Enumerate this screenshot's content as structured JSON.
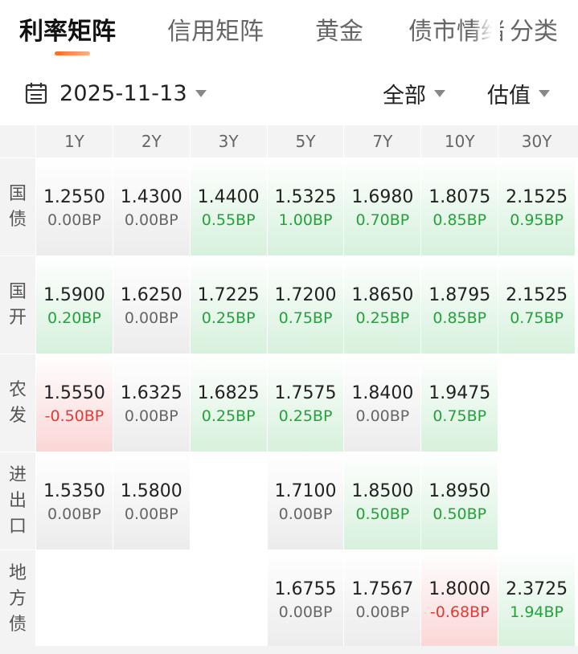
{
  "tabs": [
    {
      "label": "利率矩阵",
      "active": true
    },
    {
      "label": "信用矩阵",
      "active": false
    },
    {
      "label": "黄金",
      "active": false
    },
    {
      "label": "债市情绪",
      "active": false
    },
    {
      "label": "分类",
      "active": false
    }
  ],
  "filter": {
    "date": "2025-11-13",
    "scope": "全部",
    "metric": "估值"
  },
  "colors": {
    "up": "#22a33a",
    "down": "#e53935",
    "flat": "#666666",
    "accent": "#ff6a1f"
  },
  "matrix": {
    "columns": [
      "1Y",
      "2Y",
      "3Y",
      "5Y",
      "7Y",
      "10Y",
      "30Y"
    ],
    "rows": [
      {
        "label": "国债",
        "cells": [
          {
            "rate": "1.2550",
            "bp": "0.00BP",
            "trend": "flat"
          },
          {
            "rate": "1.4300",
            "bp": "0.00BP",
            "trend": "flat"
          },
          {
            "rate": "1.4400",
            "bp": "0.55BP",
            "trend": "up"
          },
          {
            "rate": "1.5325",
            "bp": "1.00BP",
            "trend": "up"
          },
          {
            "rate": "1.6980",
            "bp": "0.70BP",
            "trend": "up"
          },
          {
            "rate": "1.8075",
            "bp": "0.85BP",
            "trend": "up"
          },
          {
            "rate": "2.1525",
            "bp": "0.95BP",
            "trend": "up"
          }
        ]
      },
      {
        "label": "国开",
        "cells": [
          {
            "rate": "1.5900",
            "bp": "0.20BP",
            "trend": "up"
          },
          {
            "rate": "1.6250",
            "bp": "0.00BP",
            "trend": "flat"
          },
          {
            "rate": "1.7225",
            "bp": "0.25BP",
            "trend": "up"
          },
          {
            "rate": "1.7200",
            "bp": "0.75BP",
            "trend": "up"
          },
          {
            "rate": "1.8650",
            "bp": "0.25BP",
            "trend": "up"
          },
          {
            "rate": "1.8795",
            "bp": "0.85BP",
            "trend": "up"
          },
          {
            "rate": "2.1525",
            "bp": "0.75BP",
            "trend": "up"
          }
        ]
      },
      {
        "label": "农发",
        "cells": [
          {
            "rate": "1.5550",
            "bp": "-0.50BP",
            "trend": "down"
          },
          {
            "rate": "1.6325",
            "bp": "0.00BP",
            "trend": "flat"
          },
          {
            "rate": "1.6825",
            "bp": "0.25BP",
            "trend": "up"
          },
          {
            "rate": "1.7575",
            "bp": "0.25BP",
            "trend": "up"
          },
          {
            "rate": "1.8400",
            "bp": "0.00BP",
            "trend": "flat"
          },
          {
            "rate": "1.9475",
            "bp": "0.75BP",
            "trend": "up"
          },
          null
        ]
      },
      {
        "label": "进出口",
        "cells": [
          {
            "rate": "1.5350",
            "bp": "0.00BP",
            "trend": "flat"
          },
          {
            "rate": "1.5800",
            "bp": "0.00BP",
            "trend": "flat"
          },
          null,
          {
            "rate": "1.7100",
            "bp": "0.00BP",
            "trend": "flat"
          },
          {
            "rate": "1.8500",
            "bp": "0.50BP",
            "trend": "up"
          },
          {
            "rate": "1.8950",
            "bp": "0.50BP",
            "trend": "up"
          },
          null
        ]
      },
      {
        "label": "地方债",
        "cells": [
          null,
          null,
          null,
          {
            "rate": "1.6755",
            "bp": "0.00BP",
            "trend": "flat"
          },
          {
            "rate": "1.7567",
            "bp": "0.00BP",
            "trend": "flat"
          },
          {
            "rate": "1.8000",
            "bp": "-0.68BP",
            "trend": "down"
          },
          {
            "rate": "2.3725",
            "bp": "1.94BP",
            "trend": "up"
          }
        ]
      }
    ]
  }
}
